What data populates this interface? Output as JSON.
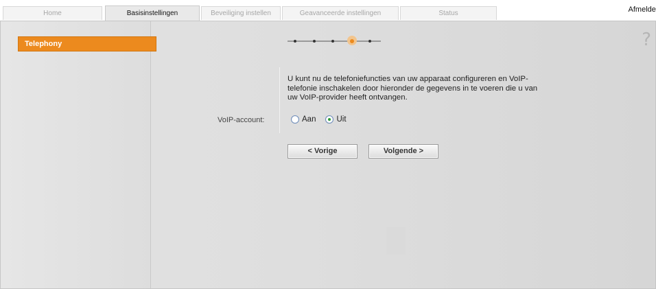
{
  "tabs": [
    {
      "label": "Home",
      "active": false
    },
    {
      "label": "Basisinstellingen",
      "active": true
    },
    {
      "label": "Beveiliging instellen",
      "active": false
    },
    {
      "label": "Geavanceerde instellingen",
      "active": false
    },
    {
      "label": "Status",
      "active": false
    }
  ],
  "logout_label": "Afmelden",
  "sidebar": {
    "items": [
      {
        "label": "Telephony",
        "selected": true
      }
    ]
  },
  "wizard": {
    "total_steps": 5,
    "current_step": 4
  },
  "description": "U kunt nu de telefoniefuncties van uw apparaat configureren en VoIP-telefonie inschakelen door hieronder de gegevens in te voeren die u van uw VoIP-provider heeft ontvangen.",
  "voip": {
    "label": "VoIP-account:",
    "options": [
      {
        "label": "Aan",
        "checked": false
      },
      {
        "label": "Uit",
        "checked": true
      }
    ]
  },
  "buttons": {
    "prev": "< Vorige",
    "next": "Volgende >"
  },
  "icons": {
    "help": "help-question-icon"
  },
  "colors": {
    "accent": "#ec8a1e",
    "radio_checked": "#2e9a35"
  }
}
